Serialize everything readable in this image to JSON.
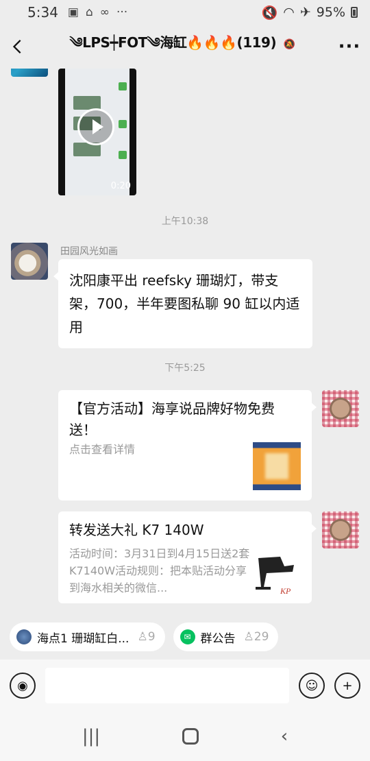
{
  "status_bar": {
    "time": "5:34",
    "battery": "95%"
  },
  "header": {
    "title": "༄LPS┿FOT༄海缸🔥🔥🔥(119)"
  },
  "messages": {
    "video": {
      "duration": "0:20"
    },
    "timestamp_1": "上午10:38",
    "text_msg": {
      "sender": "田园风光如画",
      "text": "沈阳康平出 reefsky 珊瑚灯，带支架，700，半年要图私聊 90 缸以内适用"
    },
    "timestamp_2": "下午5:25",
    "card_1": {
      "title": "【官方活动】海享说品牌好物免费送！",
      "desc": "点击查看详情"
    },
    "card_2": {
      "title": "转发送大礼 K7 140W",
      "desc": "活动时间：3月31日到4月15日送2套K7140W活动规则：把本贴活动分享到海水相关的微信..."
    }
  },
  "pins": [
    {
      "label": "海点1 珊瑚缸白...",
      "count": "9"
    },
    {
      "label": "群公告",
      "count": "29"
    }
  ],
  "colors": {
    "background": "#ededed",
    "accent_green": "#07c160"
  },
  "icons": {
    "back": "chevron-left-icon",
    "more": "more-dots-icon",
    "voice": "voice-icon",
    "emoji": "emoji-icon",
    "add": "plus-icon"
  }
}
